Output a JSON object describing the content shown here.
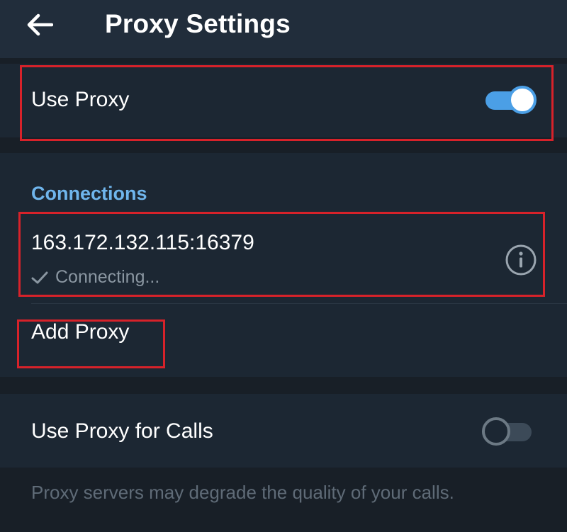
{
  "header": {
    "title": "Proxy Settings",
    "back_icon": "arrow-left-icon"
  },
  "use_proxy": {
    "label": "Use Proxy",
    "enabled": true
  },
  "connections": {
    "header": "Connections",
    "items": [
      {
        "address": "163.172.132.115:16379",
        "status": "Connecting...",
        "status_icon": "check-icon",
        "action_icon": "info-icon"
      }
    ],
    "add_label": "Add Proxy"
  },
  "calls": {
    "label": "Use Proxy for Calls",
    "enabled": false
  },
  "footer": {
    "note": "Proxy servers may degrade the quality of your calls."
  },
  "colors": {
    "accent": "#4b9fe6",
    "section_header": "#6fb5ec",
    "highlight": "#d7222a",
    "background": "#181f27",
    "surface": "#1c2733"
  }
}
